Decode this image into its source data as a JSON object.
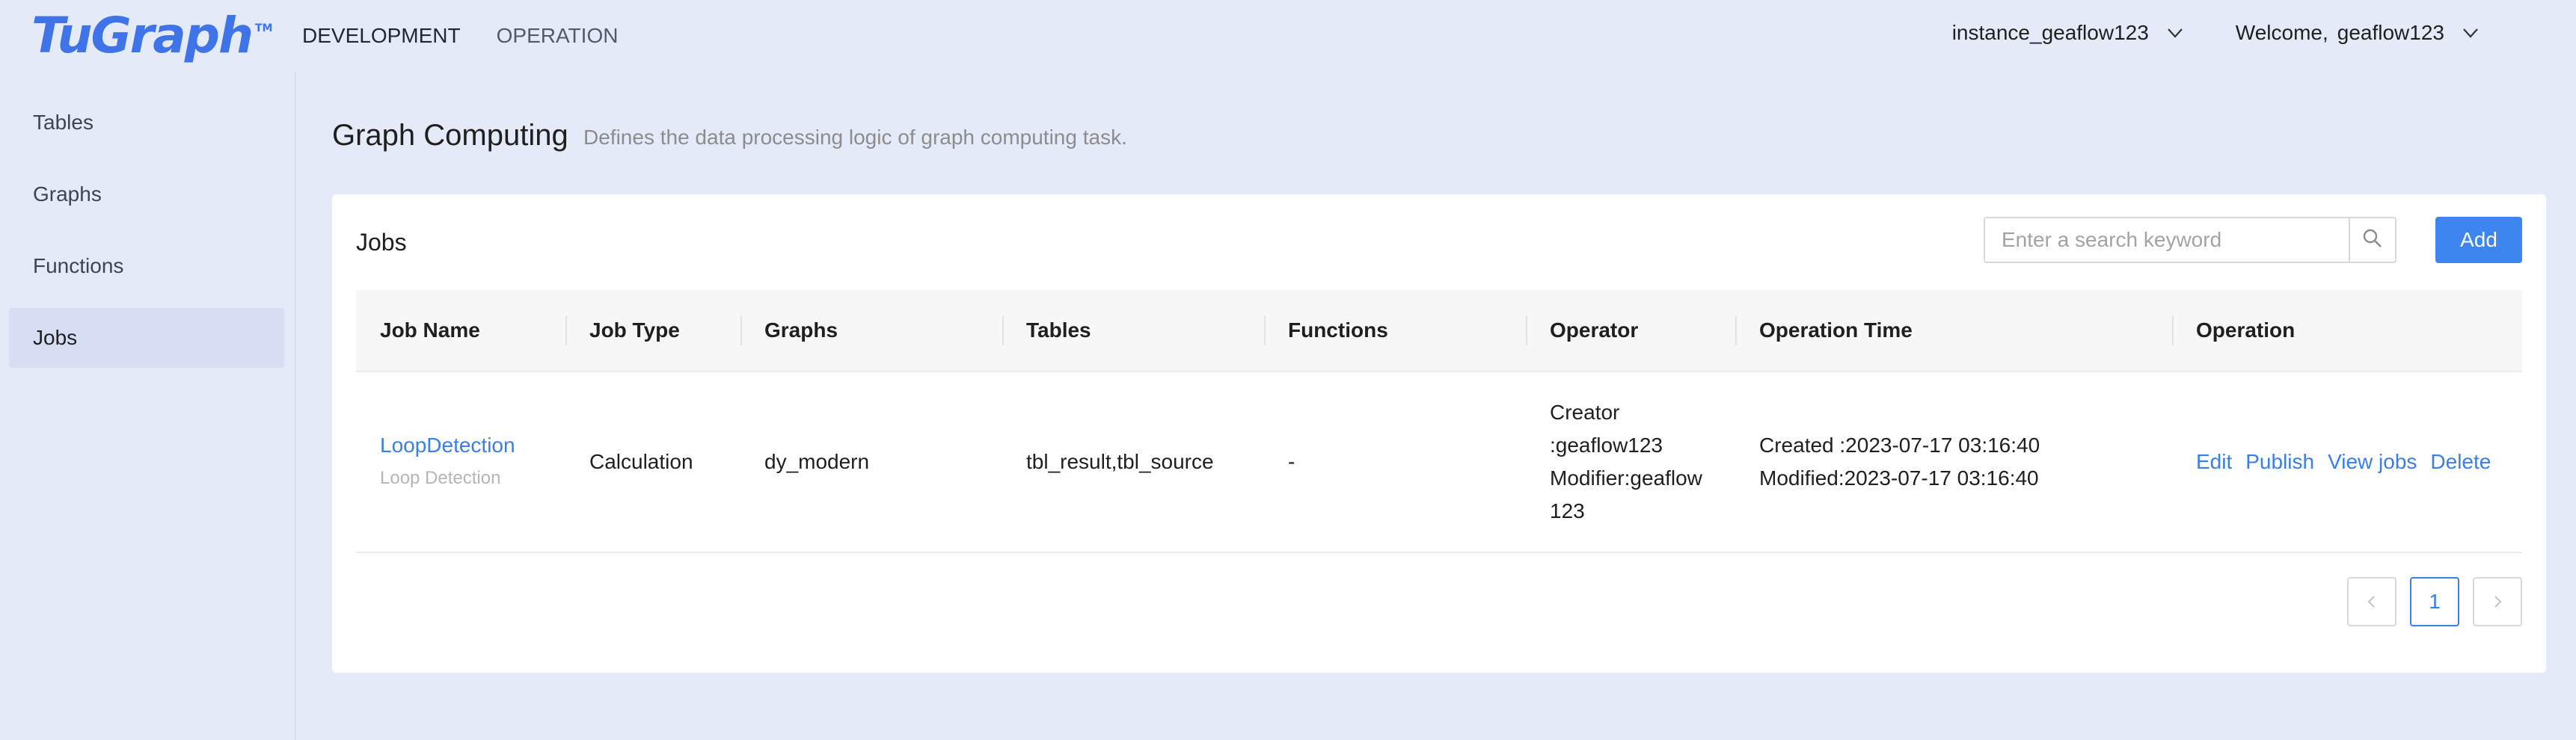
{
  "app": {
    "logo_text": "TuGraph",
    "logo_tm": "TM"
  },
  "top_nav": [
    {
      "label": "DEVELOPMENT",
      "active": true
    },
    {
      "label": "OPERATION",
      "active": false
    }
  ],
  "header": {
    "instance": "instance_geaflow123",
    "welcome_prefix": "Welcome,",
    "user": "geaflow123"
  },
  "sidebar": {
    "items": [
      {
        "label": "Tables",
        "active": false
      },
      {
        "label": "Graphs",
        "active": false
      },
      {
        "label": "Functions",
        "active": false
      },
      {
        "label": "Jobs",
        "active": true
      }
    ]
  },
  "page": {
    "title": "Graph Computing",
    "description": "Defines the data processing logic of graph computing task."
  },
  "jobs_card": {
    "title": "Jobs",
    "search_placeholder": "Enter a search keyword",
    "add_label": "Add"
  },
  "table": {
    "columns": [
      "Job Name",
      "Job Type",
      "Graphs",
      "Tables",
      "Functions",
      "Operator",
      "Operation Time",
      "Operation"
    ],
    "rows": [
      {
        "job_name": "LoopDetection",
        "job_desc": "Loop Detection",
        "job_type": "Calculation",
        "graphs": "dy_modern",
        "tables": "tbl_result,tbl_source",
        "functions": "-",
        "operator_lines": [
          "Creator",
          ":geaflow123",
          "Modifier:geaflow",
          "123"
        ],
        "time_created": "Created :2023-07-17 03:16:40",
        "time_modified": "Modified:2023-07-17 03:16:40",
        "actions": [
          "Edit",
          "Publish",
          "View jobs",
          "Delete"
        ]
      }
    ]
  },
  "pagination": {
    "current_page": "1"
  },
  "colors": {
    "accent": "#3d86f0",
    "link": "#3a7ee6",
    "background": "#e5eaf9"
  }
}
